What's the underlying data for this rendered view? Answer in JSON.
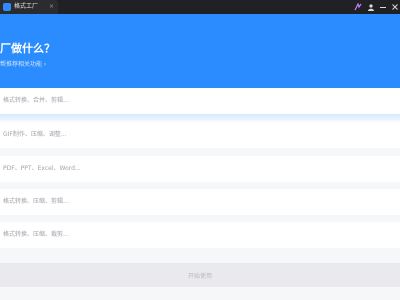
{
  "window": {
    "tab_label": "格式工厂",
    "tab_close": "×",
    "icons": [
      "brand-icon",
      "user-icon",
      "minimize-icon",
      "close-icon"
    ]
  },
  "hero": {
    "title": "厂做什么？",
    "subtitle": "帮推荐相关功能 ›"
  },
  "rows": [
    "格式转换、合并、剪辑...",
    "GIF制作、压缩、调整...",
    "PDF、PPT、Excel、Word...",
    "格式转换、压缩、剪辑...",
    "格式转换、压缩、裁剪..."
  ],
  "footer": {
    "start_label": "开始使用"
  },
  "colors": {
    "accent": "#2a8cff",
    "titlebar": "#202124",
    "background": "#f6f7f9"
  }
}
